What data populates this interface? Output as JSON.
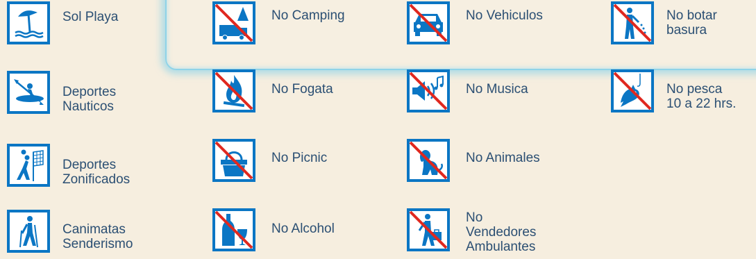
{
  "colors": {
    "icon_blue": "#0b76c4",
    "bar_red": "#e0281f",
    "text": "#2b4f73",
    "background": "#f6eedf",
    "highlight": "#8fd3e8"
  },
  "allowed": [
    {
      "icon": "beach-umbrella-icon",
      "line1": "Sol Playa",
      "line2": ""
    },
    {
      "icon": "kayak-icon",
      "line1": "Deportes",
      "line2": "Nauticos"
    },
    {
      "icon": "volleyball-icon",
      "line1": "Deportes",
      "line2": "Zonificados"
    },
    {
      "icon": "hiker-icon",
      "line1": "Canimatas",
      "line2": "Senderismo"
    }
  ],
  "prohibited": [
    {
      "icon": "no-camping-icon",
      "line1": "No Camping",
      "line2": "",
      "line3": ""
    },
    {
      "icon": "no-vehicles-icon",
      "line1": "No Vehiculos",
      "line2": "",
      "line3": ""
    },
    {
      "icon": "no-littering-icon",
      "line1": "No botar",
      "line2": "basura",
      "line3": ""
    },
    {
      "icon": "no-fire-icon",
      "line1": "No Fogata",
      "line2": "",
      "line3": ""
    },
    {
      "icon": "no-music-icon",
      "line1": "No Musica",
      "line2": "",
      "line3": ""
    },
    {
      "icon": "no-fishing-icon",
      "line1": "No pesca",
      "line2": "10 a 22 hrs.",
      "line3": ""
    },
    {
      "icon": "no-picnic-icon",
      "line1": "No Picnic",
      "line2": "",
      "line3": ""
    },
    {
      "icon": "no-animals-icon",
      "line1": "No Animales",
      "line2": "",
      "line3": ""
    },
    {
      "icon": "no-alcohol-icon",
      "line1": "No Alcohol",
      "line2": "",
      "line3": ""
    },
    {
      "icon": "no-vendors-icon",
      "line1": "No",
      "line2": "Vendedores",
      "line3": "Ambulantes"
    }
  ]
}
